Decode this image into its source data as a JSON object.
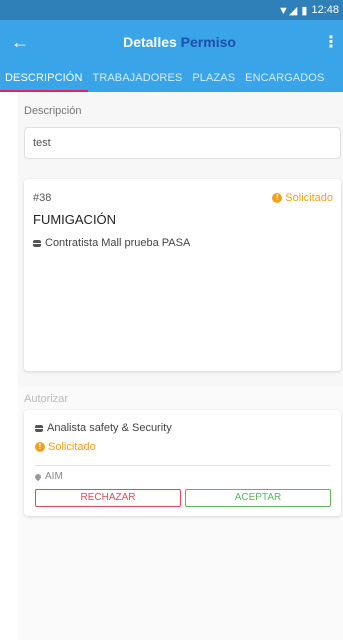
{
  "status_bar": {
    "time": "12:48"
  },
  "app_bar": {
    "title_main": "Detalles",
    "title_accent": "Permiso"
  },
  "tabs": [
    {
      "label": "DESCRIPCIÓN",
      "active": true
    },
    {
      "label": "TRABAJADORES",
      "active": false
    },
    {
      "label": "PLAZAS",
      "active": false
    },
    {
      "label": "ENCARGADOS",
      "active": false
    }
  ],
  "description": {
    "label": "Descripción",
    "value": "test"
  },
  "permit": {
    "number": "#38",
    "status": "Solicitado",
    "type": "FUMIGACIÓN",
    "contractor": "Contratista Mall prueba PASA"
  },
  "authorize": {
    "label": "Autorizar",
    "role": "Analista safety & Security",
    "status": "Solicitado",
    "place": "AIM",
    "reject_label": "RECHAZAR",
    "accept_label": "ACEPTAR"
  },
  "colors": {
    "primary": "#3aa4e8",
    "status_bar": "#2f7fb8",
    "title_accent": "#1d4fa8",
    "tab_indicator": "#e91e63",
    "pending": "#f0a21f",
    "reject": "#e04a5a",
    "accept": "#5cb85c"
  }
}
